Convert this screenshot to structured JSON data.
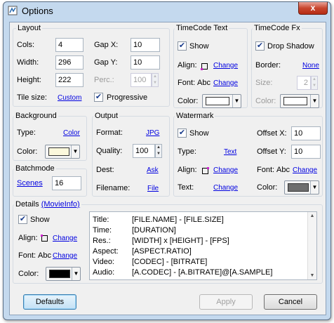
{
  "window": {
    "title": "Options",
    "close_label": "x"
  },
  "layout": {
    "title": "Layout",
    "cols_label": "Cols:",
    "cols_value": "4",
    "width_label": "Width:",
    "width_value": "296",
    "height_label": "Height:",
    "height_value": "222",
    "tile_size_label": "Tile size:",
    "tile_size_value": "Custom",
    "gapx_label": "Gap X:",
    "gapx_value": "10",
    "gapy_label": "Gap Y:",
    "gapy_value": "10",
    "perc_label": "Perc.:",
    "perc_value": "100",
    "progressive_label": "Progressive",
    "progressive_checked": true
  },
  "timecode_text": {
    "title": "TimeCode Text",
    "show_label": "Show",
    "show_checked": true,
    "align_label": "Align:",
    "align_link": "Change",
    "font_label": "Font:",
    "font_sample": "Abc",
    "font_link": "Change",
    "color_label": "Color:",
    "color_value": "#ffffff"
  },
  "timecode_fx": {
    "title": "TimeCode Fx",
    "drop_shadow_label": "Drop Shadow",
    "drop_shadow_checked": true,
    "border_label": "Border:",
    "border_value": "None",
    "size_label": "Size:",
    "size_value": "2",
    "color_label": "Color:",
    "color_value": "#ffffff"
  },
  "background": {
    "title": "Background",
    "type_label": "Type:",
    "type_value": "Color",
    "color_label": "Color:",
    "color_value": "#fbf8dc"
  },
  "output": {
    "title": "Output",
    "format_label": "Format:",
    "format_value": "JPG",
    "quality_label": "Quality:",
    "quality_value": "100",
    "dest_label": "Dest:",
    "dest_value": "Ask",
    "filename_label": "Filename:",
    "filename_value": "File"
  },
  "watermark": {
    "title": "Watermark",
    "show_label": "Show",
    "show_checked": true,
    "type_label": "Type:",
    "type_value": "Text",
    "align_label": "Align:",
    "align_link": "Change",
    "text_label": "Text:",
    "text_link": "Change",
    "offsetx_label": "Offset X:",
    "offsetx_value": "10",
    "offsety_label": "Offset Y:",
    "offsety_value": "10",
    "font_label": "Font:",
    "font_sample": "Abc",
    "font_link": "Change",
    "color_label": "Color:",
    "color_value": "#6e6e6e"
  },
  "batchmode": {
    "title": "Batchmode",
    "scenes_label": "Scenes",
    "scenes_value": "16"
  },
  "details": {
    "title": "Details",
    "movieinfo_link": "(MovieInfo)",
    "show_label": "Show",
    "show_checked": true,
    "align_label": "Align:",
    "align_link": "Change",
    "font_label": "Font:",
    "font_sample": "Abc",
    "font_link": "Change",
    "color_label": "Color:",
    "color_value": "#000000",
    "lines": [
      {
        "key": "Title:",
        "value": "[FILE.NAME] - [FILE.SIZE]"
      },
      {
        "key": "Time:",
        "value": "[DURATION]"
      },
      {
        "key": "Res.:",
        "value": "[WIDTH] x [HEIGHT] - [FPS]"
      },
      {
        "key": "Aspect:",
        "value": "[ASPECT.RATIO]"
      },
      {
        "key": "Video:",
        "value": "[CODEC] - [BITRATE]"
      },
      {
        "key": "Audio:",
        "value": "[A.CODEC] - [A.BITRATE]@[A.SAMPLE]"
      }
    ]
  },
  "buttons": {
    "defaults": "Defaults",
    "apply": "Apply",
    "cancel": "Cancel"
  }
}
